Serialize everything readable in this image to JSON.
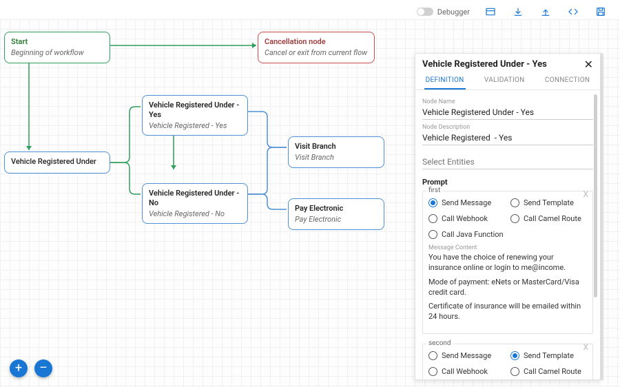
{
  "toolbar": {
    "debugger_label": "Debugger"
  },
  "canvas": {
    "start": {
      "title": "Start",
      "sub": "Beginning of workflow"
    },
    "cancel": {
      "title": "Cancellation node",
      "sub": "Cancel or exit from current flow"
    },
    "vruYes": {
      "title": "Vehicle Registered Under - Yes",
      "sub": "Vehicle Registered - Yes"
    },
    "vru": {
      "title": "Vehicle Registered Under"
    },
    "vruNo": {
      "title": "Vehicle Registered Under - No",
      "sub": "Vehicle Registered - No"
    },
    "visitBranch": {
      "title": "Visit Branch",
      "sub": "Visit Branch"
    },
    "payElec": {
      "title": "Pay Electronic",
      "sub": "Pay Electronic"
    }
  },
  "panel": {
    "title": "Vehicle Registered Under - Yes",
    "tabs": {
      "definition": "DEFINITION",
      "validation": "VALIDATION",
      "connection": "CONNECTION"
    },
    "nodeName": {
      "label": "Node Name",
      "value": "Vehicle Registered Under - Yes"
    },
    "nodeDesc": {
      "label": "Node Description",
      "value": "Vehicle Registered  - Yes"
    },
    "entities_placeholder": "Select Entities",
    "prompt_heading": "Prompt",
    "actions": {
      "sendMessage": "Send Message",
      "sendTemplate": "Send Template",
      "callWebhook": "Call Webhook",
      "callCamel": "Call Camel Route",
      "callJava": "Call Java Function"
    },
    "prompts": [
      {
        "tag": "first",
        "selected": "sendMessage",
        "msgLabel": "Message Content",
        "msgLines": [
          "You have the choice of renewing your insurance online or login to me@income.",
          "Mode of payment: eNets or MasterCard/Visa  credit card.",
          "Certificate of insurance will be emailed within 24 hours."
        ]
      },
      {
        "tag": "second",
        "selected": "sendTemplate"
      }
    ]
  },
  "fab": {
    "add": "+",
    "remove": "–"
  }
}
